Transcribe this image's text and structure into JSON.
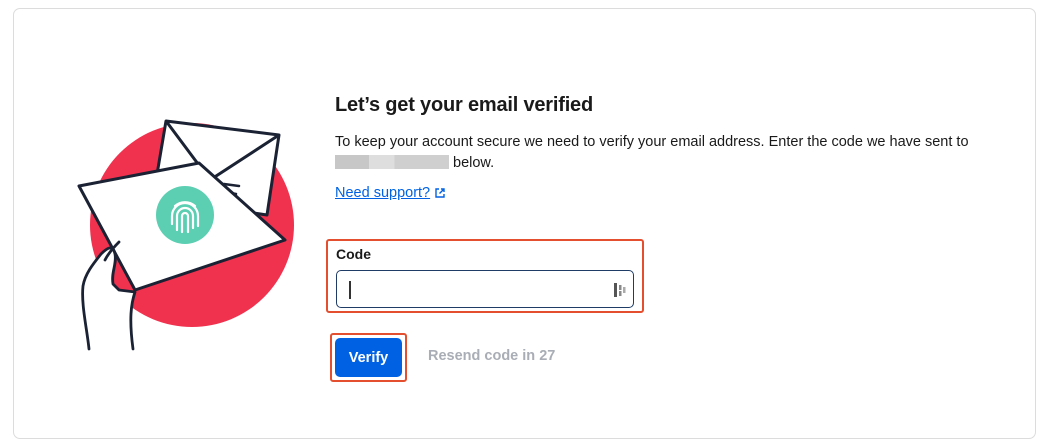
{
  "heading": "Let’s get your email verified",
  "description": {
    "line1": "To keep your account secure we need to verify your email address. Enter the code we have sent to",
    "line2_suffix": "below."
  },
  "support_link": {
    "label": "Need support?",
    "icon": "external-link-icon"
  },
  "code_field": {
    "label": "Code",
    "value": "",
    "icon": "password-manager-icon"
  },
  "verify_button": {
    "label": "Verify"
  },
  "resend": {
    "label": "Resend code in 27"
  },
  "illustration": {
    "name": "email-fingerprint-illustration",
    "circle_color": "#f0324f",
    "badge_color": "#5ccfb2"
  },
  "colors": {
    "accent": "#0062e3",
    "highlight": "#e4502f",
    "muted": "#a9adb5"
  }
}
